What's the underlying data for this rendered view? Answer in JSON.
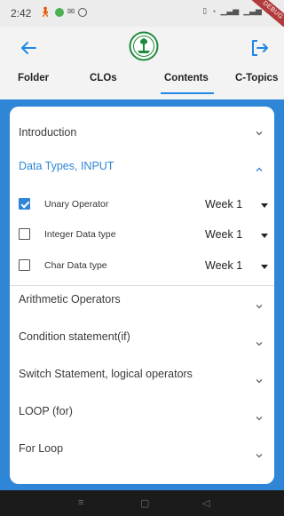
{
  "status_bar": {
    "time": "2:42",
    "network": "4G"
  },
  "debug_banner": "DEBUG",
  "tabs": [
    {
      "label": "Folder"
    },
    {
      "label": "CLOs"
    },
    {
      "label": "Contents"
    },
    {
      "label": "C-Topics"
    }
  ],
  "active_tab": "Contents",
  "topics": [
    {
      "label": "Introduction",
      "expanded": false
    },
    {
      "label": "Data Types, INPUT",
      "expanded": true,
      "subtopics": [
        {
          "label": "Unary Operator",
          "checked": true,
          "week": "Week 1"
        },
        {
          "label": "Integer Data type",
          "checked": false,
          "week": "Week 1"
        },
        {
          "label": "Char Data type",
          "checked": false,
          "week": "Week 1"
        }
      ]
    },
    {
      "label": "Arithmetic Operators",
      "expanded": false
    },
    {
      "label": "Condition statement(if)",
      "expanded": false
    },
    {
      "label": "Switch Statement, logical operators",
      "expanded": false
    },
    {
      "label": "LOOP (for)",
      "expanded": false
    },
    {
      "label": "For Loop",
      "expanded": false
    }
  ],
  "colors": {
    "accent": "#2f86d6",
    "active_topic_text": "#2f86d6",
    "logo_green": "#1f8a3b"
  },
  "icons": {
    "back": "arrow-left-icon",
    "logout": "logout-icon",
    "logo": "university-logo",
    "expand": "chevron-down-icon",
    "collapse": "chevron-up-icon"
  }
}
